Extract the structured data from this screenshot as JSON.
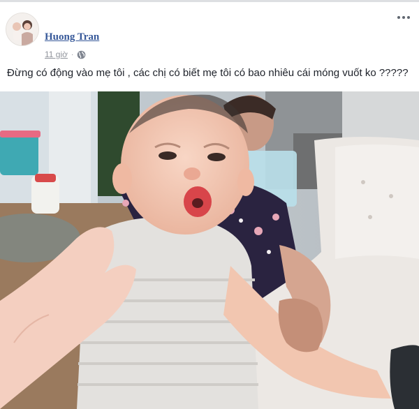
{
  "post": {
    "author": "Huong Tran",
    "timestamp": "11 giờ",
    "separator": "·",
    "text": "Đừng có động vào mẹ tôi , các chị có biết mẹ tôi có bao nhiêu cái móng vuốt ko ?????",
    "privacy_icon": "globe-icon",
    "more_icon": "ellipsis-icon"
  },
  "photo": {
    "description_icon": "photo",
    "colors": {
      "wall": "#c9cfd3",
      "sofa": "#ece8e4",
      "floral_dress": "#2a2340",
      "skin": "#f3c9b3",
      "lips": "#d8454a"
    }
  },
  "colors": {
    "link": "#365899",
    "meta": "#90949c",
    "text": "#1d2129"
  }
}
